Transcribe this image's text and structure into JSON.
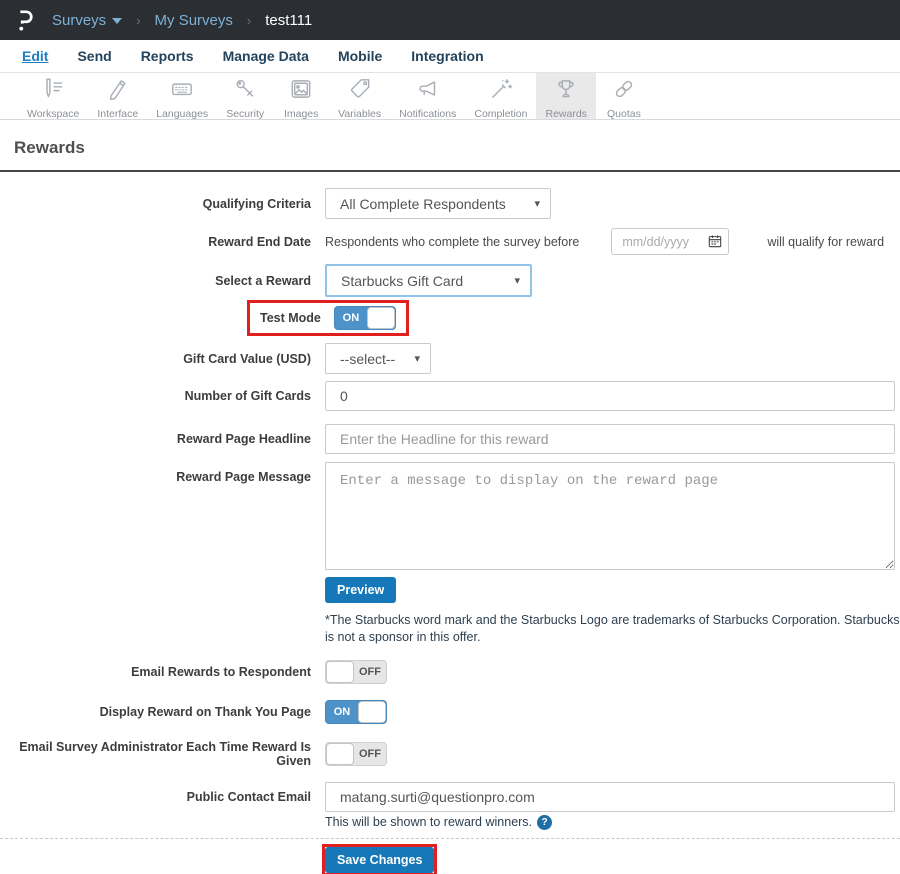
{
  "topbar": {
    "breadcrumb": [
      "Surveys",
      "My Surveys",
      "test111"
    ]
  },
  "menu": {
    "items": [
      "Edit",
      "Send",
      "Reports",
      "Manage Data",
      "Mobile",
      "Integration"
    ],
    "active": "Edit"
  },
  "toolbar": {
    "items": [
      "Workspace",
      "Interface",
      "Languages",
      "Security",
      "Images",
      "Variables",
      "Notifications",
      "Completion",
      "Rewards",
      "Quotas"
    ],
    "active": "Rewards"
  },
  "page": {
    "title": "Rewards"
  },
  "form": {
    "qualifying_criteria": {
      "label": "Qualifying Criteria",
      "value": "All Complete Respondents"
    },
    "reward_end_date": {
      "label": "Reward End Date",
      "prefix": "Respondents who complete the survey before",
      "placeholder": "mm/dd/yyyy",
      "suffix": "will qualify for reward"
    },
    "select_reward": {
      "label": "Select a Reward",
      "value": "Starbucks Gift Card"
    },
    "test_mode": {
      "label": "Test Mode",
      "state": "ON"
    },
    "gift_card_value": {
      "label": "Gift Card Value (USD)",
      "value": "--select--"
    },
    "num_gift_cards": {
      "label": "Number of Gift Cards",
      "value": "0"
    },
    "headline": {
      "label": "Reward Page Headline",
      "placeholder": "Enter the Headline for this reward"
    },
    "message": {
      "label": "Reward Page Message",
      "placeholder": "Enter a message to display on the reward page"
    },
    "preview_button": "Preview",
    "trademark_note": "*The Starbucks word mark and the Starbucks Logo are trademarks of Starbucks Corporation. Starbucks is not a sponsor in this offer.",
    "email_rewards": {
      "label": "Email Rewards to Respondent",
      "state": "OFF"
    },
    "display_reward": {
      "label": "Display Reward on Thank You Page",
      "state": "ON"
    },
    "email_admin": {
      "label": "Email Survey Administrator Each Time Reward Is Given",
      "state": "OFF"
    },
    "public_contact_email": {
      "label": "Public Contact Email",
      "value": "matang.surti@questionpro.com",
      "helper": "This will be shown to reward winners.",
      "help_icon": "?"
    },
    "save_button": "Save Changes"
  },
  "colors": {
    "topbar_bg": "#2b2e33",
    "breadcrumb_link": "#7cb1d6",
    "accent_blue": "#1678b8",
    "toggle_on_blue": "#4d92c9",
    "annotation_red": "#e01f1f",
    "focus_border_blue": "#8fc3e8"
  }
}
